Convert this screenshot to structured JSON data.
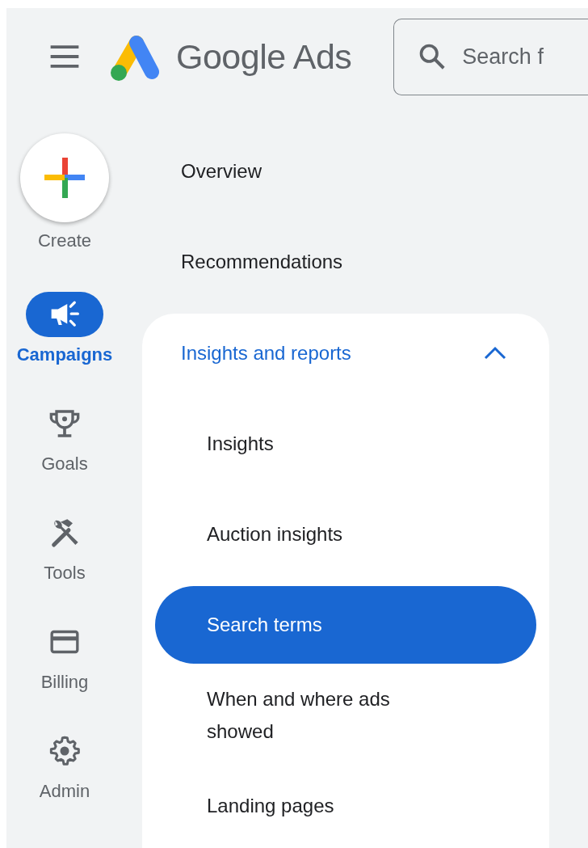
{
  "header": {
    "brand": "Google Ads",
    "search": {
      "placeholder": "Search f"
    }
  },
  "rail": {
    "create": "Create",
    "items": [
      {
        "label": "Campaigns",
        "kind": "campaigns",
        "selected": true
      },
      {
        "label": "Goals",
        "kind": "goals",
        "selected": false
      },
      {
        "label": "Tools",
        "kind": "tools",
        "selected": false
      },
      {
        "label": "Billing",
        "kind": "billing",
        "selected": false
      },
      {
        "label": "Admin",
        "kind": "admin",
        "selected": false
      }
    ]
  },
  "nav": {
    "items": [
      {
        "label": "Overview"
      },
      {
        "label": "Recommendations"
      },
      {
        "label": "Insights and reports",
        "expanded": true,
        "children": [
          {
            "label": "Insights",
            "selected": false
          },
          {
            "label": "Auction insights",
            "selected": false
          },
          {
            "label": "Search terms",
            "selected": true
          },
          {
            "label": "When and where ads showed",
            "selected": false
          },
          {
            "label": "Landing pages",
            "selected": false
          }
        ]
      }
    ]
  }
}
